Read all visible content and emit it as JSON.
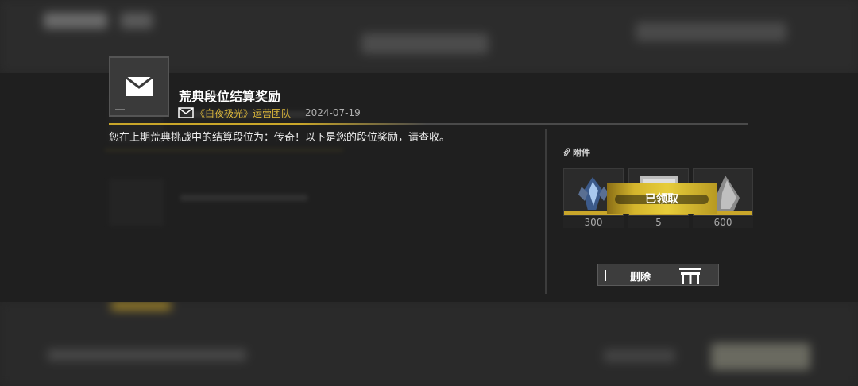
{
  "mail": {
    "title": "荒典段位结算奖励",
    "sender": "《白夜极光》运营团队",
    "date": "2024-07-19",
    "body": "您在上期荒典挑战中的结算段位为：传奇！以下是您的段位奖励，请查收。"
  },
  "attachments": {
    "label": "附件",
    "items": [
      {
        "icon": "crystal-emblem-icon",
        "quantity": "300"
      },
      {
        "icon": "scroll-item-icon",
        "quantity": "5"
      },
      {
        "icon": "cloak-item-icon",
        "quantity": "600"
      }
    ],
    "claimed_label": "已领取"
  },
  "actions": {
    "delete_label": "删除"
  },
  "colors": {
    "accent_gold": "#c9a62a",
    "sender_gold": "#d9b53a",
    "panel_bg": "#1f1f1f"
  }
}
